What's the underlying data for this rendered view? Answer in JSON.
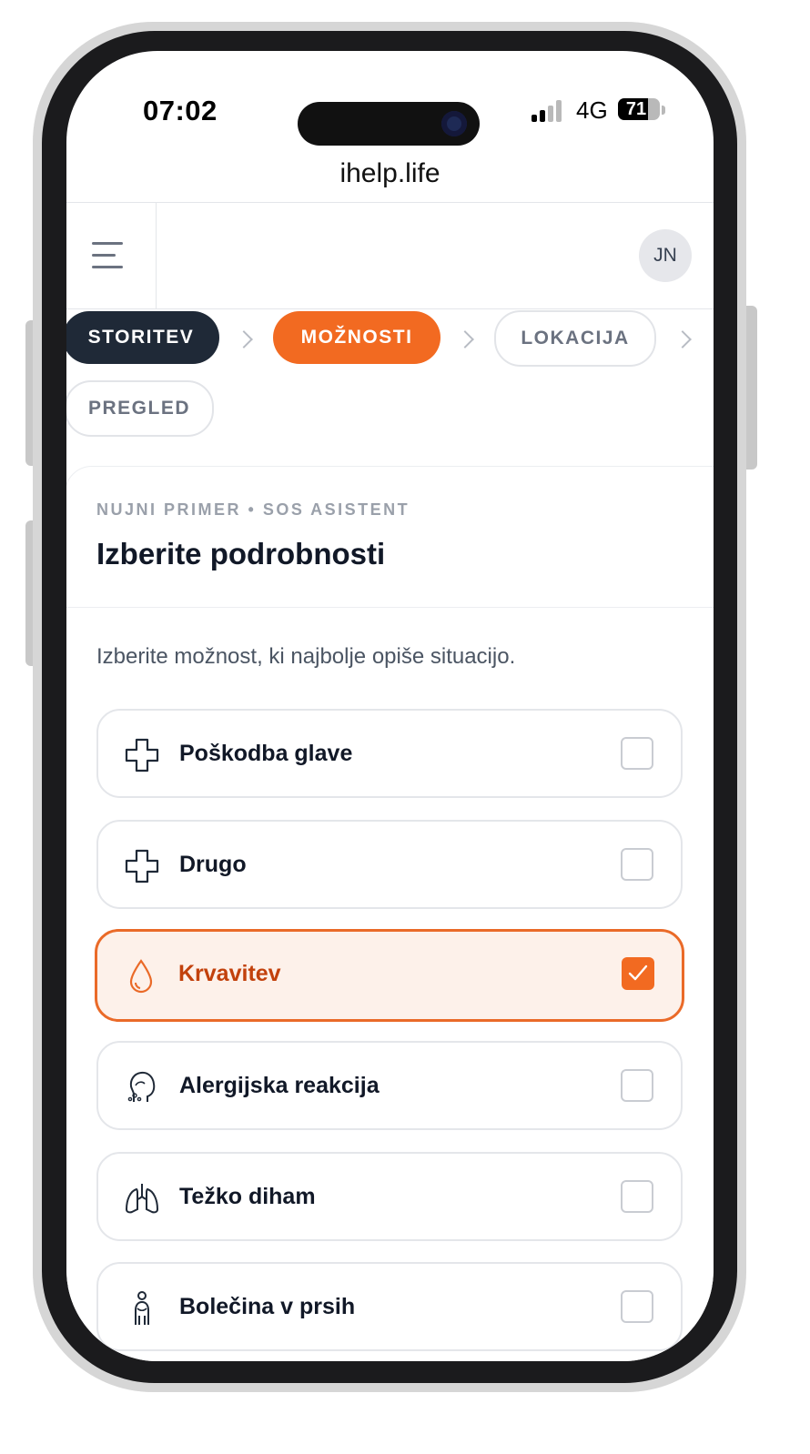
{
  "status_bar": {
    "time": "07:02",
    "network": "4G",
    "battery": "71",
    "battery_level": 0.71
  },
  "browser": {
    "url": "ihelp.life"
  },
  "header": {
    "avatar_initials": "JN"
  },
  "steps": [
    {
      "label": "STORITEV",
      "state": "done"
    },
    {
      "label": "MOŽNOSTI",
      "state": "active"
    },
    {
      "label": "LOKACIJA",
      "state": "upcoming"
    },
    {
      "label": "PREGLED",
      "state": "upcoming"
    }
  ],
  "card": {
    "kicker": "NUJNI PRIMER • SOS ASISTENT",
    "title": "Izberite podrobnosti",
    "intro": "Izberite možnost, ki najbolje opiše situacijo."
  },
  "options": [
    {
      "label": "Poškodba glave",
      "icon": "medical-cross-icon",
      "checked": false
    },
    {
      "label": "Drugo",
      "icon": "medical-cross-icon",
      "checked": false
    },
    {
      "label": "Krvavitev",
      "icon": "blood-drop-icon",
      "checked": true
    },
    {
      "label": "Alergijska reakcija",
      "icon": "allergy-head-icon",
      "checked": false
    },
    {
      "label": "Težko diham",
      "icon": "lungs-icon",
      "checked": false
    },
    {
      "label": "Bolečina v prsih",
      "icon": "chest-pain-icon",
      "checked": false
    }
  ],
  "colors": {
    "accent": "#f26a21",
    "accent_bg": "#fdf1ea",
    "dark_step": "#1f2937",
    "text": "#111827",
    "muted": "#9aa0aa"
  }
}
